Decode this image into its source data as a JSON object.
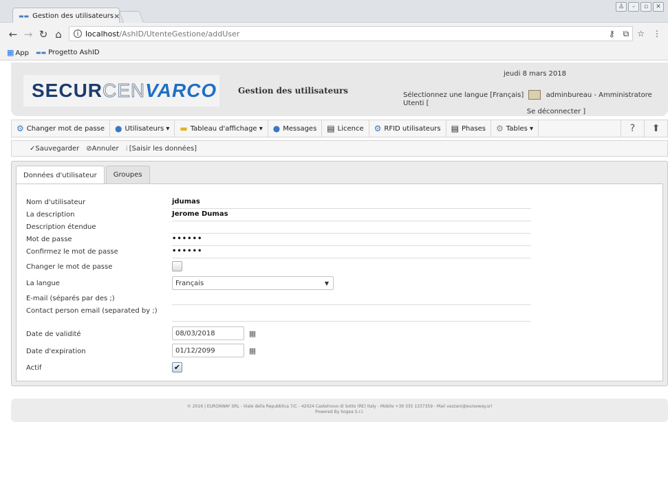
{
  "browser": {
    "tab_title": "Gestion des utilisateurs",
    "tab_close": "×",
    "url_host": "localhost",
    "url_path": "/AshID/UtenteGestione/addUser",
    "bookmarks": [
      "App",
      "Progetto AshID"
    ]
  },
  "header": {
    "logo_part1": "SECUR",
    "logo_part2": "CEN",
    "logo_part3": "VARCO",
    "page_title": "Gestion des utilisateurs",
    "date": "jeudi 8 mars 2018",
    "language_prompt": "Sélectionnez une langue [Français]",
    "user_info": "adminbureau - Amministratore Utenti [",
    "logout": "Se déconnecter ]"
  },
  "menu": {
    "items": [
      {
        "label": "Changer mot de passe",
        "icon": "users-key-icon"
      },
      {
        "label": "Utilisateurs ▾",
        "icon": "user-icon"
      },
      {
        "label": "Tableau d'affichage ▾",
        "icon": "folder-icon"
      },
      {
        "label": "Messages",
        "icon": "chat-bubble-icon"
      },
      {
        "label": "Licence",
        "icon": "license-icon"
      },
      {
        "label": "RFID utilisateurs",
        "icon": "rfid-users-icon"
      },
      {
        "label": "Phases",
        "icon": "phases-icon"
      },
      {
        "label": "Tables ▾",
        "icon": "tables-gear-icon"
      }
    ],
    "help": "?",
    "up": "⬆"
  },
  "toolbar": {
    "save": "✓Sauvegarder",
    "cancel": "⊘Annuler",
    "input": "[Saisir les données]"
  },
  "form_tabs": [
    "Données d'utilisateur",
    "Groupes"
  ],
  "form": {
    "username_label": "Nom d'utilisateur",
    "username": "jdumas",
    "description_label": "La description",
    "description": "Jerome Dumas",
    "ext_description_label": "Description étendue",
    "ext_description": "",
    "password_label": "Mot de passe",
    "password": "••••••",
    "confirm_label": "Confirmez le mot de passe",
    "confirm": "••••••",
    "change_pw_label": "Changer le mot de passe",
    "change_pw": false,
    "language_label": "La langue",
    "language": "Français",
    "email_label": "E-mail (séparés par des ;)",
    "email": "",
    "contact_label": "Contact person email (separated by ;)",
    "contact": "",
    "valid_label": "Date de validité",
    "valid_date": "08/03/2018",
    "expiry_label": "Date d'expiration",
    "expiry_date": "01/12/2099",
    "active_label": "Actif",
    "active": true
  },
  "footer": {
    "line1": "© 2016 | EUROXWAY SRL - Viale della Repubblica 7/C - 42024 Castelnovo di Sotto (RE) Italy - Mobile +39 335 1337359 - Mail vezzani@euroxway.srl",
    "line2": "Powered By Sogea S.r.l."
  }
}
